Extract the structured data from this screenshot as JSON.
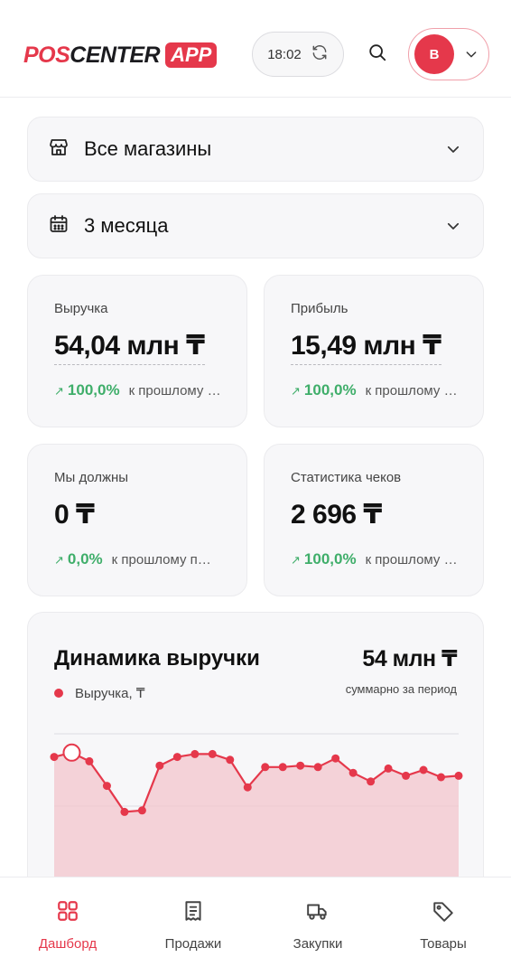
{
  "header": {
    "logo": {
      "pos": "POS",
      "center": "CENTER",
      "app": "APP"
    },
    "sync_time": "18:02",
    "avatar_letter": "B"
  },
  "filters": {
    "store": {
      "label": "Все магазины",
      "icon": "store-icon"
    },
    "period": {
      "label": "3 месяца",
      "icon": "calendar-icon"
    }
  },
  "cards": [
    {
      "title": "Выручка",
      "value": "54,04 млн ₸",
      "delta_arrow": "↗",
      "delta": "100,0%",
      "note": "к прошлому периоду"
    },
    {
      "title": "Прибыль",
      "value": "15,49 млн ₸",
      "delta_arrow": "↗",
      "delta": "100,0%",
      "note": "к прошлому периоду"
    },
    {
      "title": "Мы должны",
      "value": "0 ₸",
      "delta_arrow": "↗",
      "delta": "0,0%",
      "note": "к прошлому периоду"
    },
    {
      "title": "Статистика чеков",
      "value": "2 696 ₸",
      "delta_arrow": "↗",
      "delta": "100,0%",
      "note": "к прошлому периоду"
    }
  ],
  "revenue_chart": {
    "title": "Динамика выручки",
    "total": "54 млн ₸",
    "total_caption": "суммарно за период",
    "legend": "Выручка, ₸",
    "colors": {
      "line": "#e5384b",
      "area": "#f3c6cc"
    }
  },
  "chart_data": {
    "type": "area",
    "series": [
      {
        "name": "Выручка, ₸",
        "values": [
          0.84,
          0.87,
          0.81,
          0.64,
          0.46,
          0.47,
          0.78,
          0.84,
          0.86,
          0.86,
          0.82,
          0.63,
          0.77,
          0.77,
          0.78,
          0.77,
          0.83,
          0.73,
          0.67,
          0.76,
          0.71,
          0.75,
          0.7,
          0.71
        ]
      }
    ],
    "highlight_index": 1,
    "grid": true
  },
  "bottom_nav": [
    {
      "label": "Дашборд",
      "icon": "dashboard-icon",
      "active": true
    },
    {
      "label": "Продажи",
      "icon": "receipt-icon",
      "active": false
    },
    {
      "label": "Закупки",
      "icon": "truck-icon",
      "active": false
    },
    {
      "label": "Товары",
      "icon": "tag-icon",
      "active": false
    }
  ]
}
